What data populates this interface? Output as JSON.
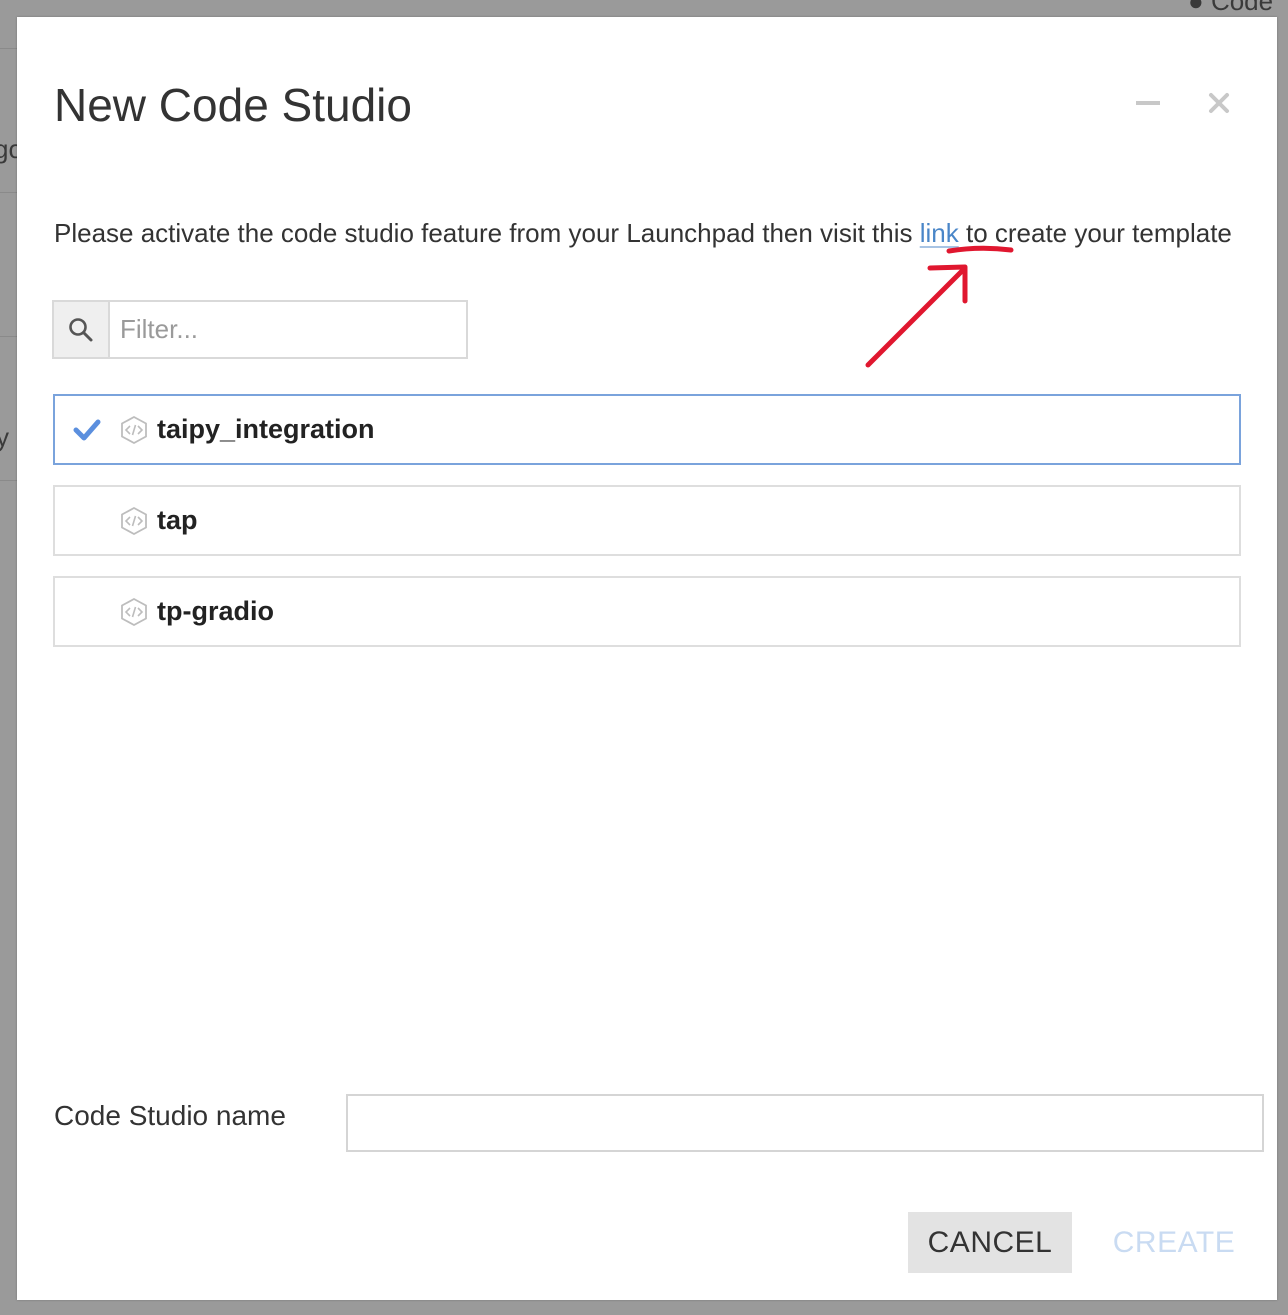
{
  "background": {
    "fragments": [
      "Code",
      "go",
      "y"
    ]
  },
  "dialog": {
    "title": "New Code Studio",
    "minimize_icon": "minimize-icon",
    "close_icon": "close-icon"
  },
  "message": {
    "before_link": "Please activate the code studio feature from your Launchpad then visit this ",
    "link_text": "link",
    "after_link": " to create your template"
  },
  "filter": {
    "icon": "search-icon",
    "placeholder": "Filter...",
    "value": ""
  },
  "templates": [
    {
      "name": "taipy_integration",
      "selected": true,
      "icon": "code-icon"
    },
    {
      "name": "tap",
      "selected": false,
      "icon": "code-icon"
    },
    {
      "name": "tp-gradio",
      "selected": false,
      "icon": "code-icon"
    }
  ],
  "name_field": {
    "label": "Code Studio name",
    "value": ""
  },
  "buttons": {
    "cancel": "CANCEL",
    "create": "CREATE"
  },
  "colors": {
    "link": "#4a86c8",
    "selected_border": "#7aa3dc",
    "check": "#5b8fde",
    "annotation": "#e0172f",
    "create_disabled": "#c9dbf2"
  }
}
